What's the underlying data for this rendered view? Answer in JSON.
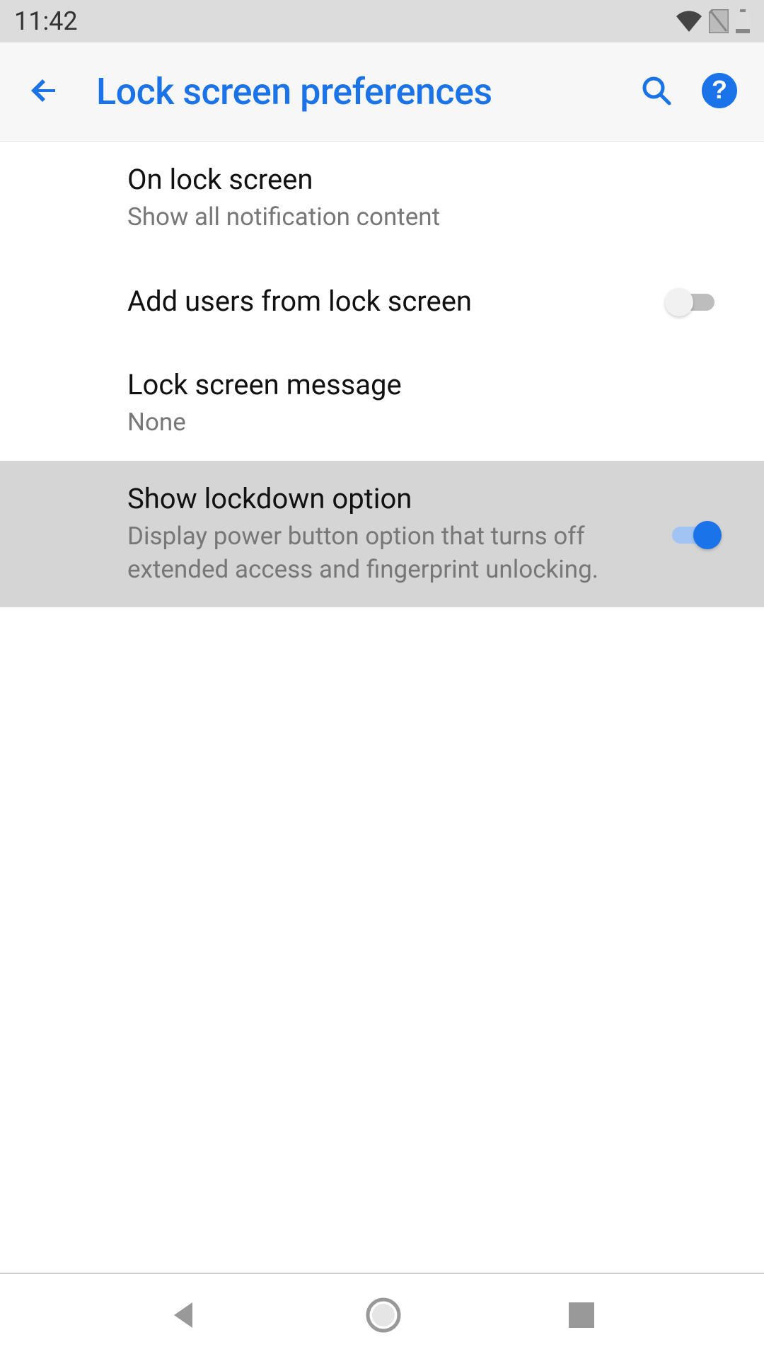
{
  "status_bar": {
    "time": "11:42"
  },
  "action_bar": {
    "title": "Lock screen preferences"
  },
  "prefs": [
    {
      "title": "On lock screen",
      "subtitle": "Show all notification content"
    },
    {
      "title": "Add users from lock screen"
    },
    {
      "title": "Lock screen message",
      "subtitle": "None"
    },
    {
      "title": "Show lockdown option",
      "subtitle": "Display power button option that turns off extended access and fingerprint unlocking."
    }
  ],
  "colors": {
    "accent": "#1a73e8"
  }
}
